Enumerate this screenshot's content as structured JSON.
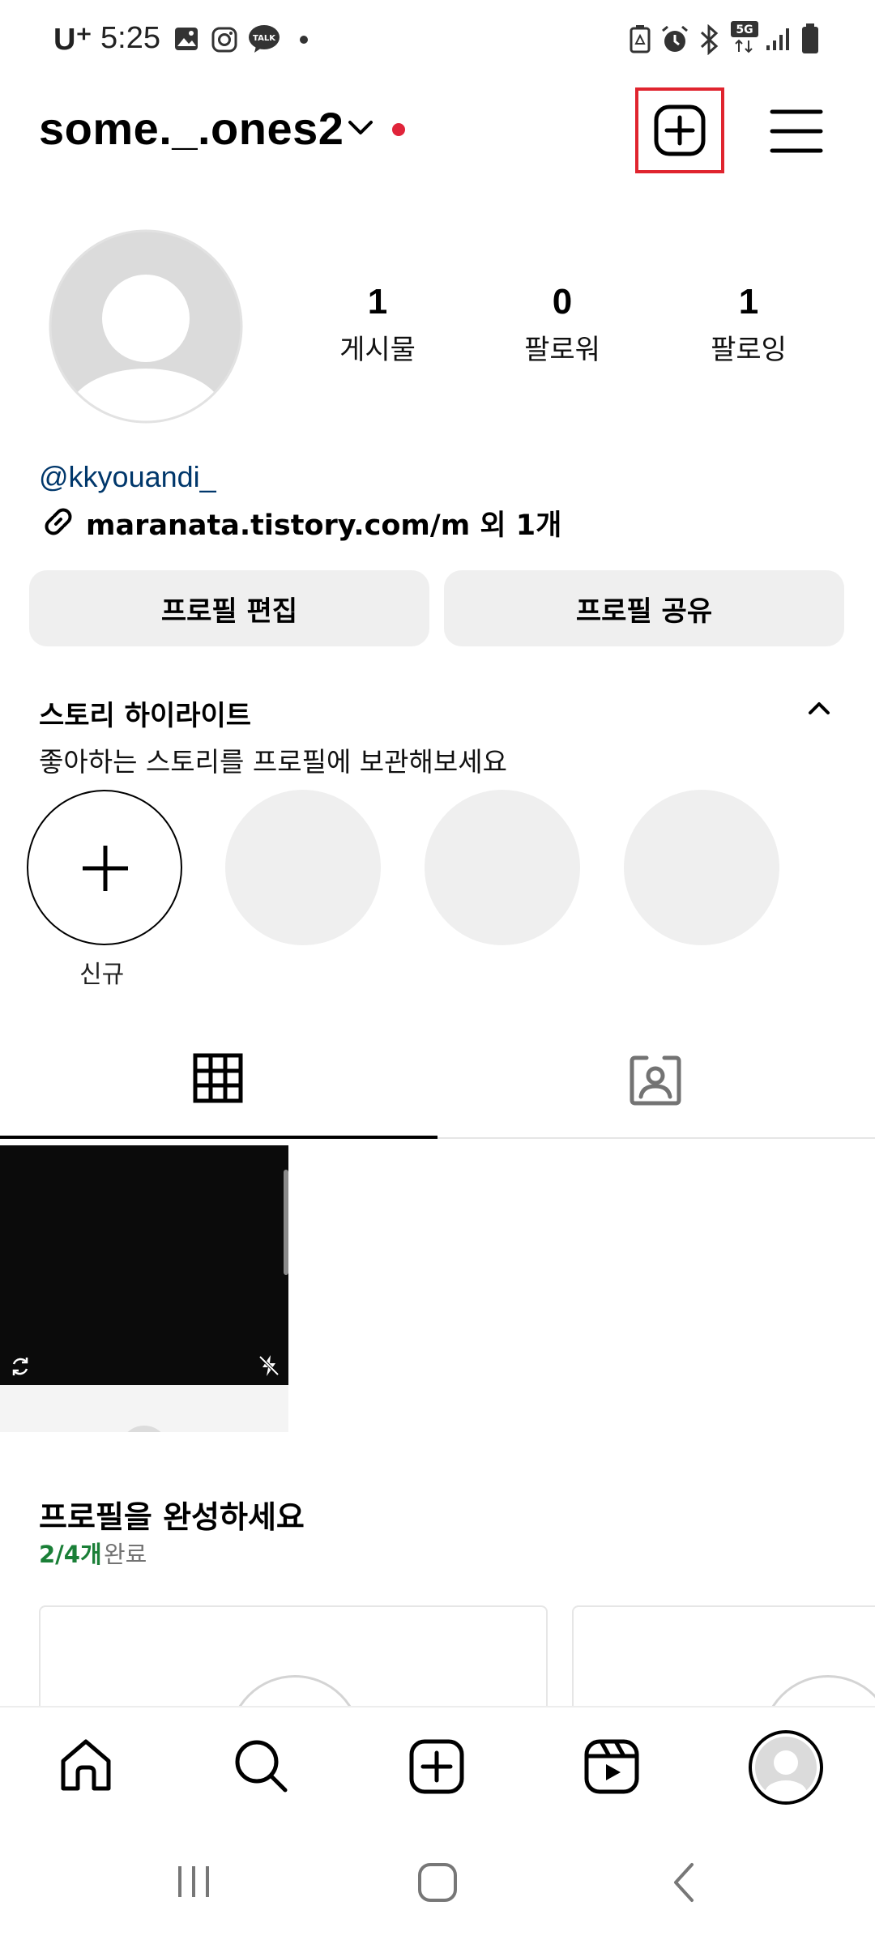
{
  "status_bar": {
    "carrier": "U⁺",
    "time": "5:25"
  },
  "header": {
    "username": "some._.ones2"
  },
  "profile": {
    "stats": [
      {
        "value": "1",
        "label": "게시물"
      },
      {
        "value": "0",
        "label": "팔로워"
      },
      {
        "value": "1",
        "label": "팔로잉"
      }
    ],
    "mention": "@kkyouandi_",
    "link_text": "maranata.tistory.com/m 외 1개"
  },
  "buttons": {
    "edit_profile": "프로필 편집",
    "share_profile": "프로필 공유"
  },
  "highlights": {
    "title": "스토리 하이라이트",
    "subtitle": "좋아하는 스토리를 프로필에 보관해보세요",
    "new_label": "신규"
  },
  "complete_profile": {
    "title": "프로필을 완성하세요",
    "progress_count": "2/4개",
    "progress_suffix": "완료",
    "progress_fraction": 0.5
  },
  "colors": {
    "accent_green": "#1a7f37",
    "link_blue": "#00376b",
    "highlight_red": "#e0242e"
  },
  "icons": {
    "header": [
      "chevron-down-icon",
      "new-post-icon",
      "menu-icon"
    ],
    "tabs": [
      "grid-icon",
      "tagged-icon"
    ],
    "bottom_nav": [
      "home-icon",
      "search-icon",
      "create-icon",
      "reels-icon",
      "profile-avatar-icon"
    ]
  }
}
